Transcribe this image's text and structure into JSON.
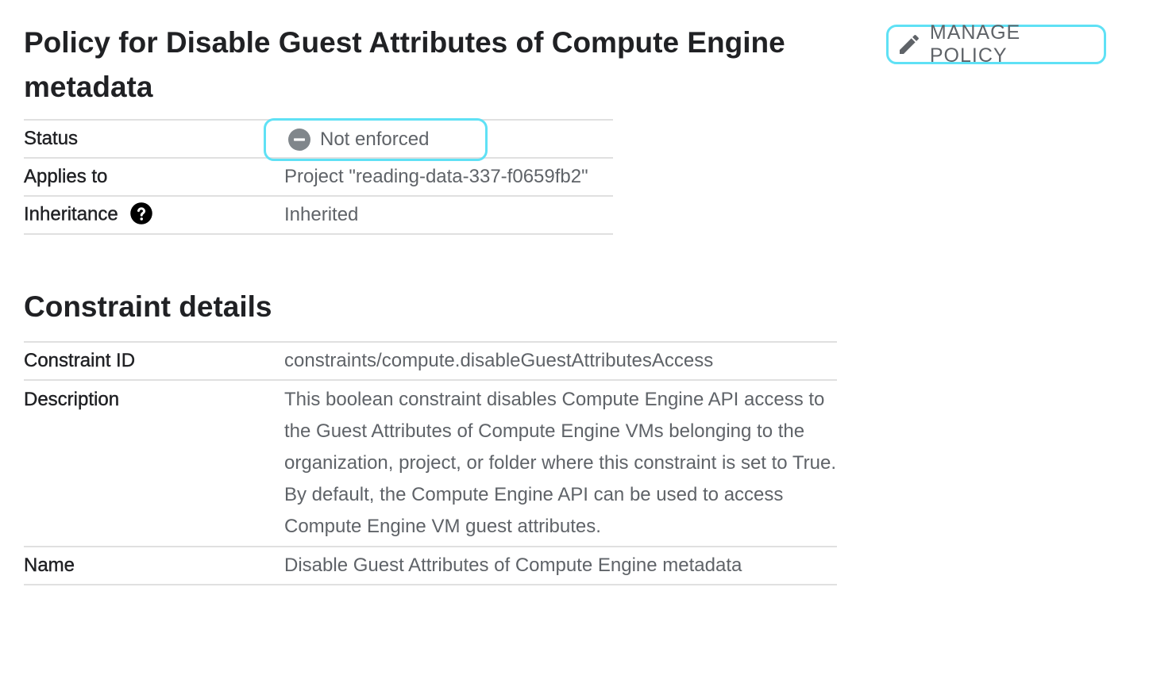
{
  "policy": {
    "title": "Policy for Disable Guest Attributes of Compute Engine metadata",
    "manage_button_label": "MANAGE POLICY",
    "rows": {
      "status": {
        "key": "Status",
        "value": "Not enforced"
      },
      "applies_to": {
        "key": "Applies to",
        "value": "Project \"reading-data-337-f0659fb2\""
      },
      "inheritance": {
        "key": "Inheritance",
        "value": "Inherited"
      }
    }
  },
  "constraint": {
    "section_title": "Constraint details",
    "rows": {
      "constraint_id": {
        "key": "Constraint ID",
        "value": "constraints/compute.disableGuestAttributesAccess"
      },
      "description": {
        "key": "Description",
        "value": "This boolean constraint disables Compute Engine API access to the Guest Attributes of Compute Engine VMs belonging to the organization, project, or folder where this constraint is set to True. By default, the Compute Engine API can be used to access Compute Engine VM guest attributes."
      },
      "name": {
        "key": "Name",
        "value": "Disable Guest Attributes of Compute Engine metadata"
      }
    }
  },
  "icons": {
    "manage": "pencil-icon",
    "status": "minus-circle-icon",
    "inheritance_help": "help-circle-icon"
  },
  "colors": {
    "highlight": "#5fe1f5",
    "text_primary": "#202124",
    "text_secondary": "#5f6368",
    "divider": "#e0e0e0"
  }
}
